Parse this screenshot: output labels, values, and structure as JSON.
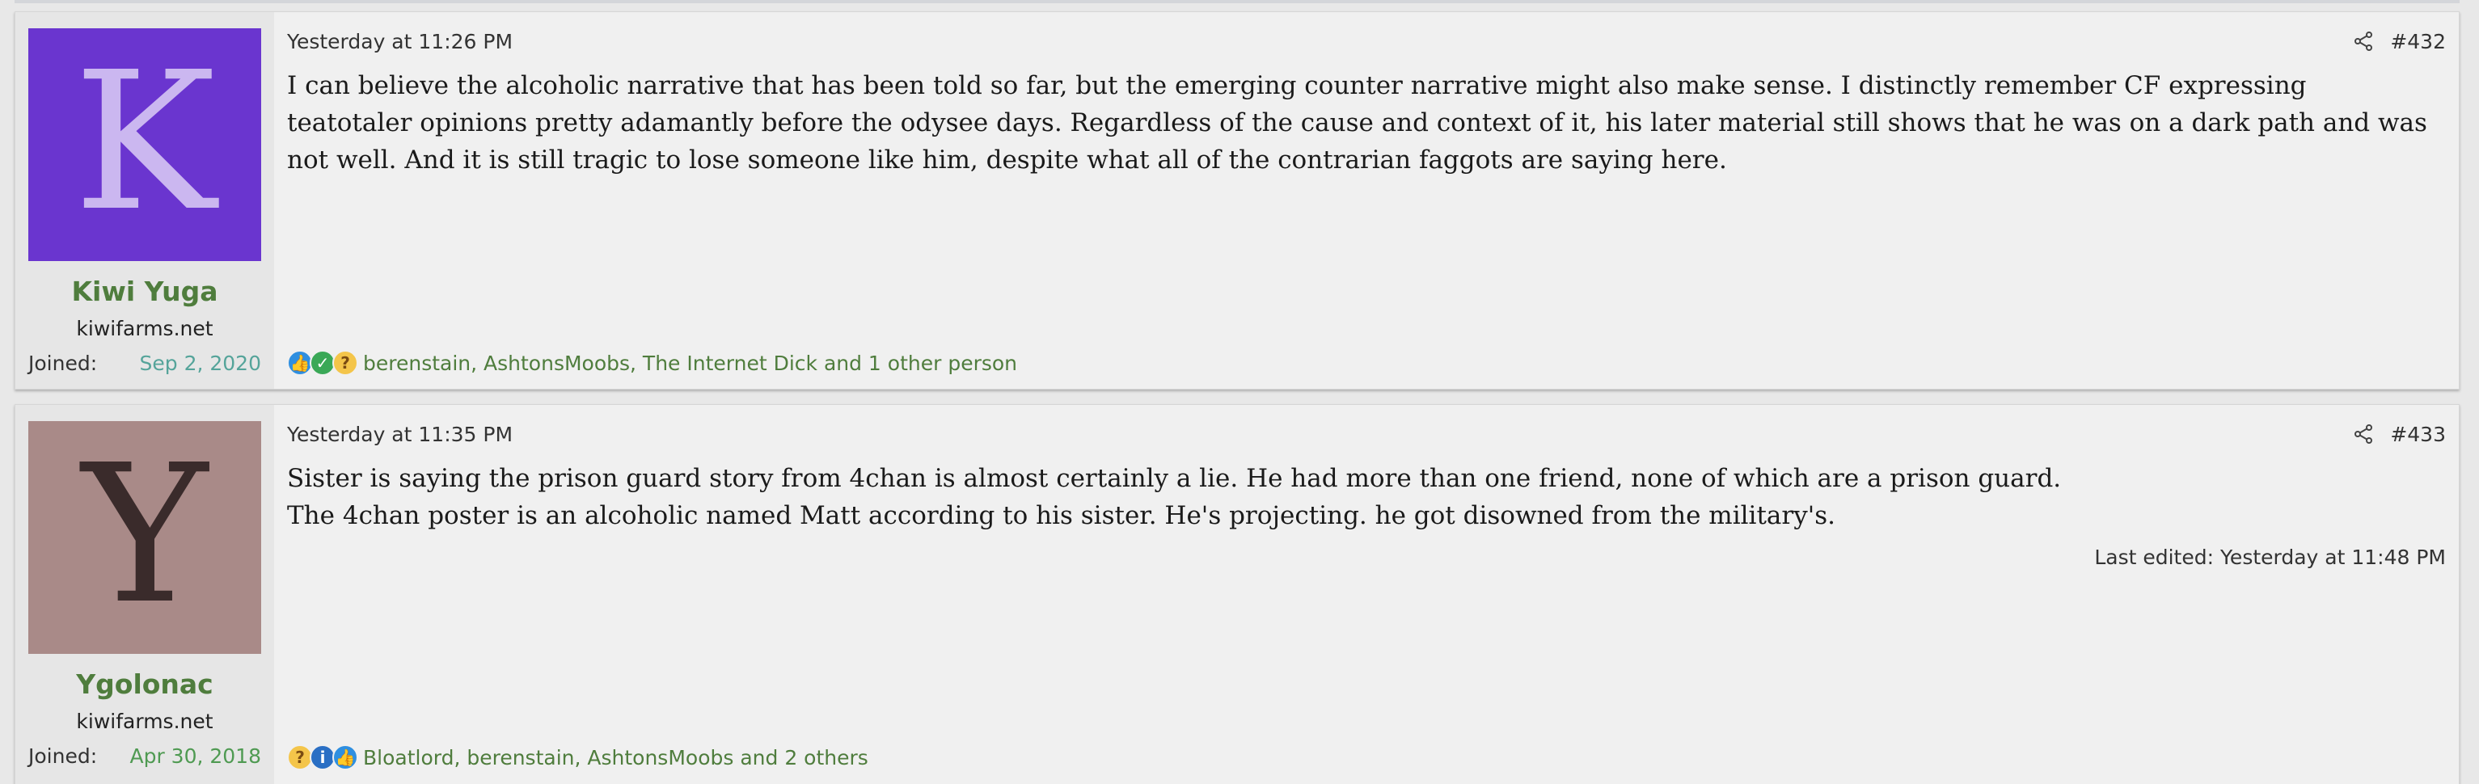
{
  "posts": [
    {
      "avatar_letter": "K",
      "avatar_bg": "#6a35cf",
      "username": "Kiwi Yuga",
      "user_title": "kiwifarms.net",
      "joined_label": "Joined:",
      "joined_value": "Sep 2, 2020",
      "timestamp": "Yesterday at 11:26 PM",
      "post_number": "#432",
      "message": [
        "I can believe the alcoholic narrative that has been told so far, but the emerging counter narrative might also make sense. I distinctly remember CF expressing teatotaler opinions pretty adamantly before the odysee days. Regardless of the cause and context of it, his later material still shows that he was on a dark path and was not well. And it is still tragic to lose someone like him, despite what all of the contrarian faggots are saying here."
      ],
      "edited": "",
      "reaction_icons": [
        "like-icon",
        "check-icon",
        "thinking-icon"
      ],
      "reactions_text": "berenstain, AshtonsMoobs, The Internet Dick and 1 other person"
    },
    {
      "avatar_letter": "Y",
      "avatar_bg": "#a98a88",
      "username": "Ygolonac",
      "user_title": "kiwifarms.net",
      "joined_label": "Joined:",
      "joined_value": "Apr 30, 2018",
      "timestamp": "Yesterday at 11:35 PM",
      "post_number": "#433",
      "message": [
        "Sister is saying the prison guard story from 4chan is almost certainly a lie. He had more than one friend, none of which are a prison guard.",
        "The 4chan poster is an alcoholic named Matt according to his sister. He's projecting. he got disowned from the military's."
      ],
      "edited": "Last edited: Yesterday at 11:48 PM",
      "reaction_icons": [
        "thinking-icon",
        "info-icon",
        "like-icon"
      ],
      "reactions_text": "Bloatlord, berenstain, AshtonsMoobs and 2 others"
    }
  ]
}
